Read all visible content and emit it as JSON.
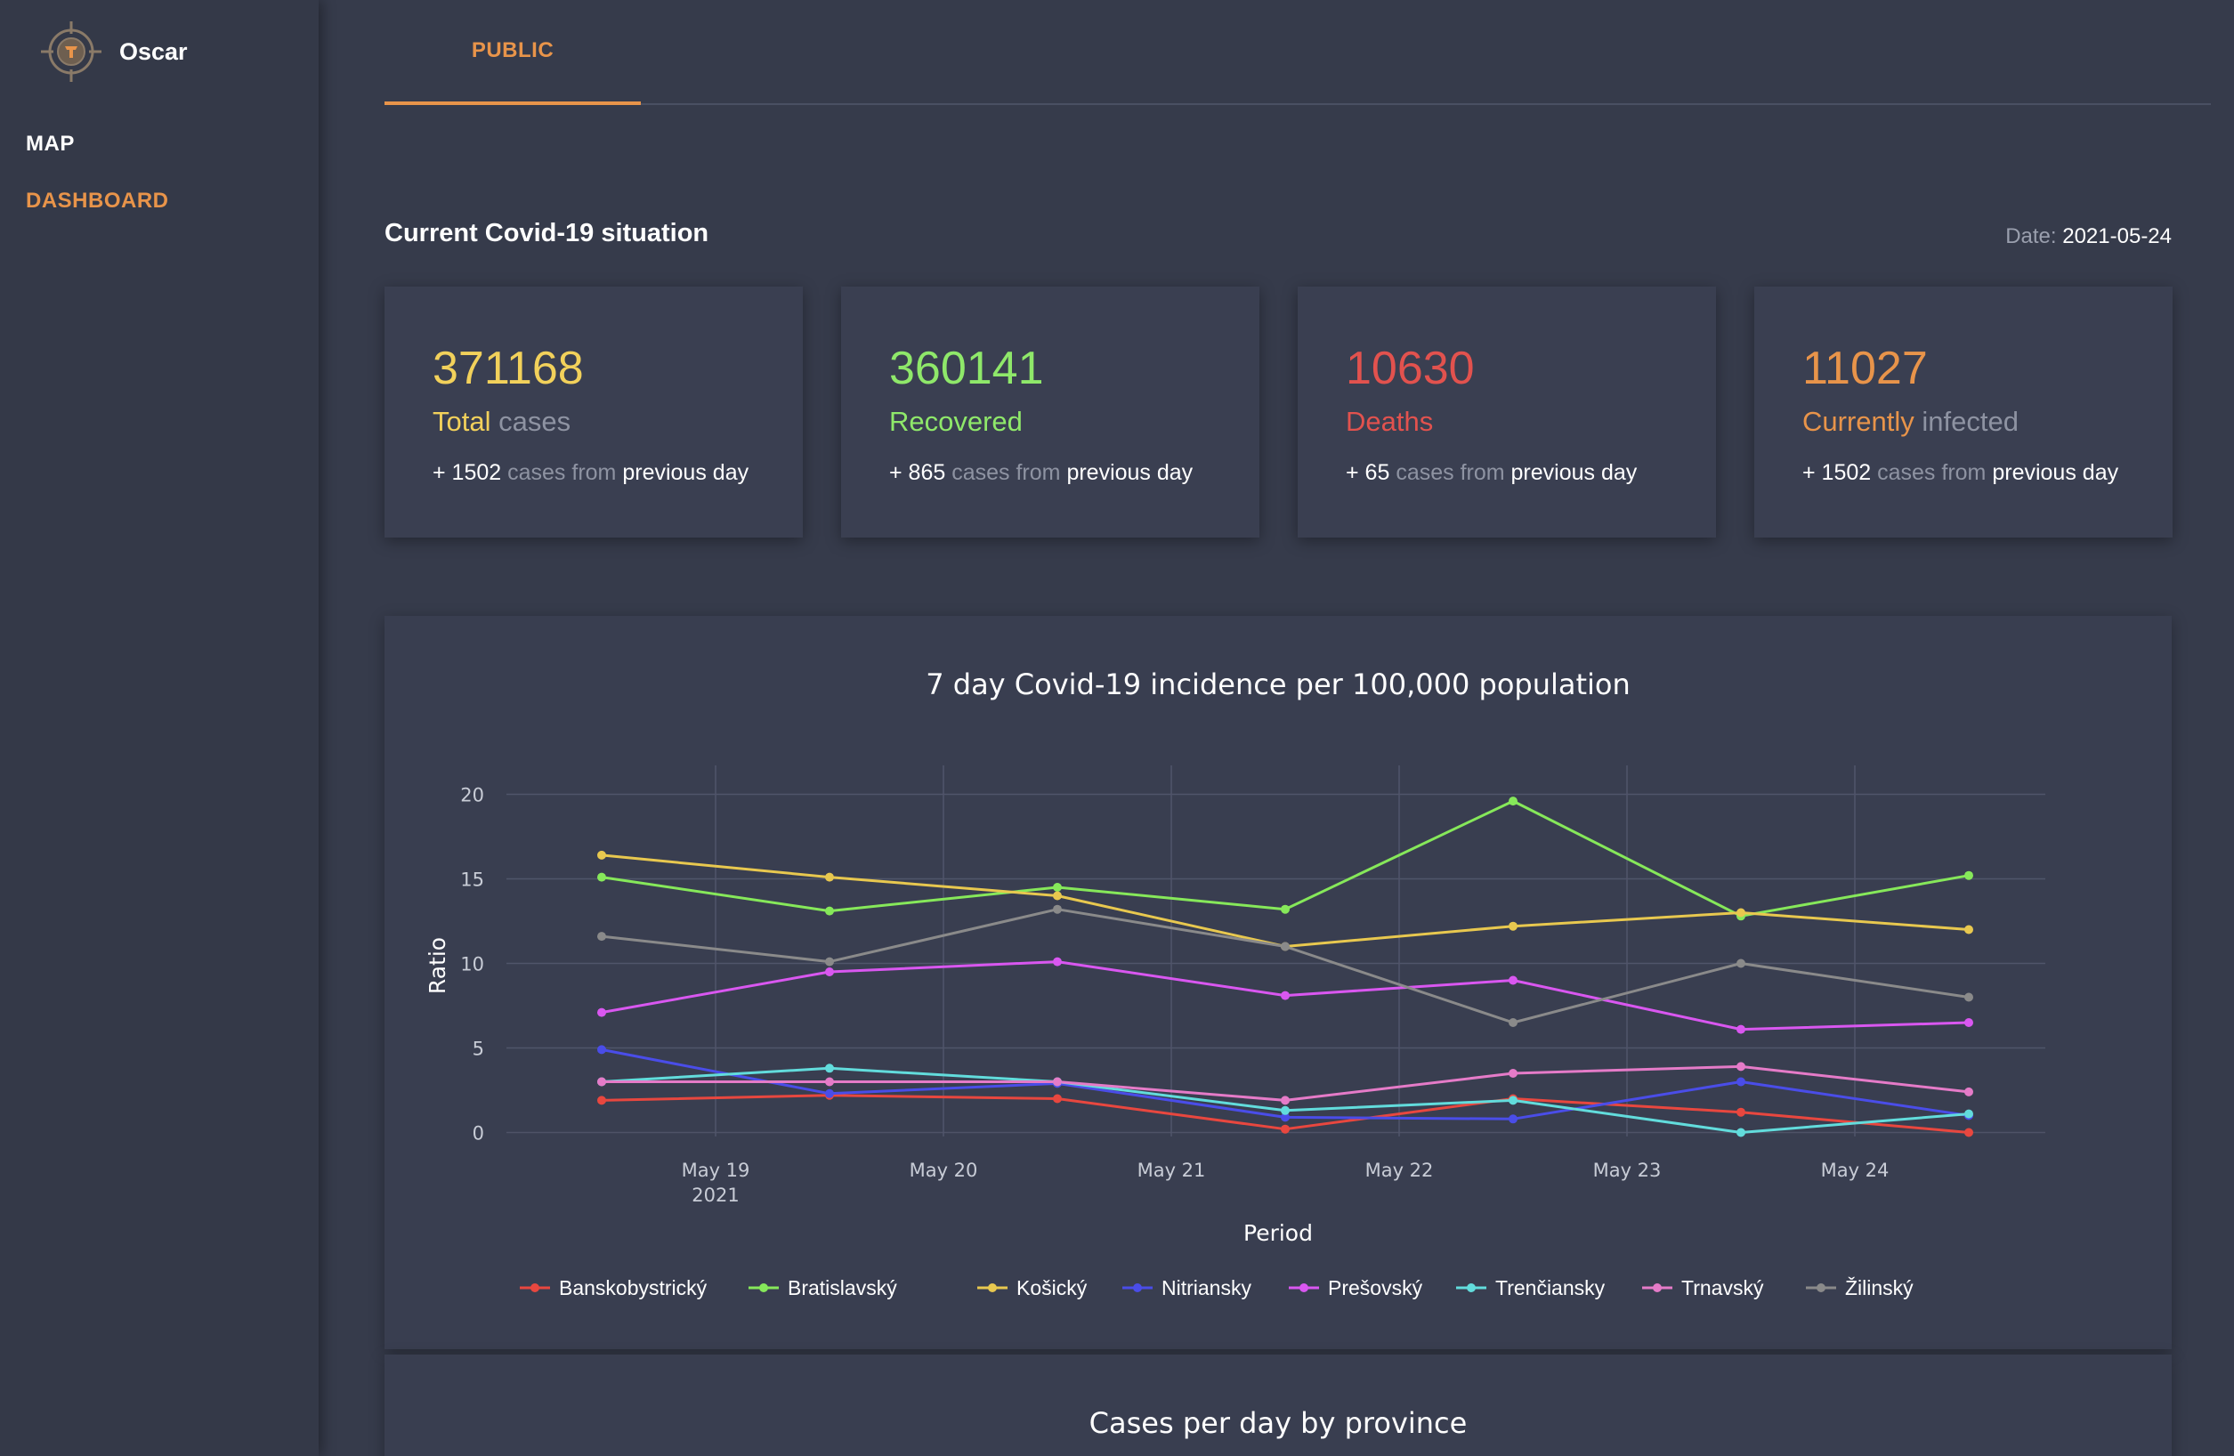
{
  "app": {
    "name": "Oscar"
  },
  "nav": {
    "items": [
      {
        "label": "MAP"
      },
      {
        "label": "DASHBOARD"
      }
    ]
  },
  "tabs": [
    {
      "label": "PUBLIC"
    }
  ],
  "section": {
    "title": "Current Covid-19 situation",
    "date_label": "Date:",
    "date_value": "2021-05-24"
  },
  "cards": [
    {
      "value": "371168",
      "label_main": "Total",
      "label_muted": "cases",
      "delta": "+ 1502",
      "delta_muted": "cases from",
      "delta_tail": "previous day",
      "color": "#f2d15b"
    },
    {
      "value": "360141",
      "label_main": "Recovered",
      "label_muted": "",
      "delta": "+ 865",
      "delta_muted": "cases from",
      "delta_tail": "previous day",
      "color": "#8fe86a"
    },
    {
      "value": "10630",
      "label_main": "Deaths",
      "label_muted": "",
      "delta": "+ 65",
      "delta_muted": "cases from",
      "delta_tail": "previous day",
      "color": "#e2524e"
    },
    {
      "value": "11027",
      "label_main": "Currently",
      "label_muted": "infected",
      "delta": "+ 1502",
      "delta_muted": "cases from",
      "delta_tail": "previous day",
      "color": "#e8944a"
    }
  ],
  "chart_data": [
    {
      "type": "line",
      "title": "7 day Covid-19 incidence per 100,000 population",
      "xlabel": "Period",
      "ylabel": "Ratio",
      "x": [
        "2021-05-18 12:00",
        "2021-05-19 12:00",
        "2021-05-20 12:00",
        "2021-05-21 12:00",
        "2021-05-22 12:00",
        "2021-05-23 12:00",
        "2021-05-24 12:00"
      ],
      "x_ticks": [
        "May 19",
        "May 20",
        "May 21",
        "May 22",
        "May 23",
        "May 24"
      ],
      "x_tick_sub": "2021",
      "y_ticks": [
        0,
        5,
        10,
        15,
        20
      ],
      "ylim": [
        -0.5,
        21
      ],
      "grid": true,
      "legend": "bottom",
      "series": [
        {
          "name": "Banskobystrický",
          "color": "#e8473f",
          "values": [
            1.9,
            2.2,
            2.0,
            0.2,
            2.0,
            1.2,
            0.0
          ]
        },
        {
          "name": "Bratislavský",
          "color": "#86e85a",
          "values": [
            15.1,
            13.1,
            14.5,
            13.2,
            19.6,
            12.8,
            15.2
          ]
        },
        {
          "name": "Košický",
          "color": "#e8c84f",
          "values": [
            16.4,
            15.1,
            14.0,
            11.0,
            12.2,
            13.0,
            12.0
          ]
        },
        {
          "name": "Nitriansky",
          "color": "#4a4de8",
          "values": [
            4.9,
            2.3,
            2.9,
            0.9,
            0.8,
            3.0,
            1.0
          ]
        },
        {
          "name": "Prešovský",
          "color": "#d957f0",
          "values": [
            7.1,
            9.5,
            10.1,
            8.1,
            9.0,
            6.1,
            6.5
          ]
        },
        {
          "name": "Trenčiansky",
          "color": "#62dcdc",
          "values": [
            3.0,
            3.8,
            3.0,
            1.3,
            1.9,
            0.0,
            1.1
          ]
        },
        {
          "name": "Trnavský",
          "color": "#e57bc8",
          "values": [
            3.0,
            3.0,
            3.0,
            1.9,
            3.5,
            3.9,
            2.4
          ]
        },
        {
          "name": "Žilinský",
          "color": "#8a8a8a",
          "values": [
            11.6,
            10.1,
            13.2,
            11.0,
            6.5,
            10.0,
            8.0
          ]
        }
      ]
    },
    {
      "type": "bar",
      "title": "Cases per day by province"
    }
  ]
}
